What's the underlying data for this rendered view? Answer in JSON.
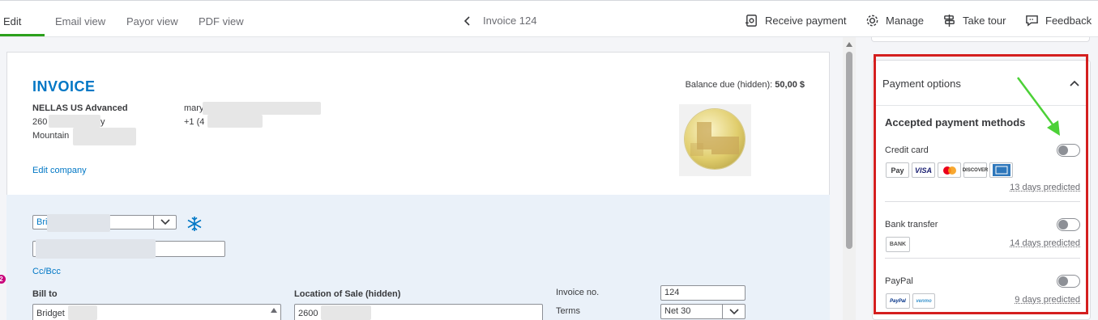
{
  "tabs": [
    {
      "label": "Edit",
      "active": true
    },
    {
      "label": "Email view"
    },
    {
      "label": "Payor view"
    },
    {
      "label": "PDF view"
    }
  ],
  "nav": {
    "title": "Invoice 124",
    "back_icon": "chevron-left-icon"
  },
  "toolbar": {
    "receive_payment": "Receive payment",
    "manage": "Manage",
    "take_tour": "Take tour",
    "feedback": "Feedback"
  },
  "invoice": {
    "title": "INVOICE",
    "balance_label": "Balance due (hidden):",
    "balance_value": "50,00 $",
    "company_name": "NELLAS US Advanced",
    "address_line1": "260",
    "address_line1_tail": "y",
    "address_line2": "Mountain",
    "email_partial": "mary",
    "phone_partial": "+1 (4",
    "edit_company": "Edit company"
  },
  "customer": {
    "name_partial": "Bri",
    "cc_bcc": "Cc/Bcc",
    "bill_to_label": "Bill to",
    "bill_to_value": "Bridget",
    "location_label": "Location of Sale (hidden)",
    "location_value": "2600",
    "invoice_no_label": "Invoice no.",
    "invoice_no_value": "124",
    "terms_label": "Terms",
    "terms_value": "Net 30"
  },
  "notification_badge": "2",
  "payment_options": {
    "title": "Payment options",
    "accepted_title": "Accepted payment methods",
    "methods": [
      {
        "label": "Credit card",
        "enabled": false,
        "predicted": "13 days predicted",
        "chips": [
          "Pay",
          "VISA",
          "MC",
          "DISCOVER",
          "AMEX"
        ]
      },
      {
        "label": "Bank transfer",
        "enabled": false,
        "predicted": "14 days predicted",
        "chips": [
          "BANK"
        ]
      },
      {
        "label": "PayPal",
        "enabled": false,
        "predicted": "9 days predicted",
        "chips": [
          "PayPal",
          "venmo"
        ]
      }
    ]
  },
  "colors": {
    "accent": "#0077c5",
    "active_tab": "#2ca01c",
    "highlight": "#d41f1f",
    "annotation_arrow": "#4cd137"
  }
}
